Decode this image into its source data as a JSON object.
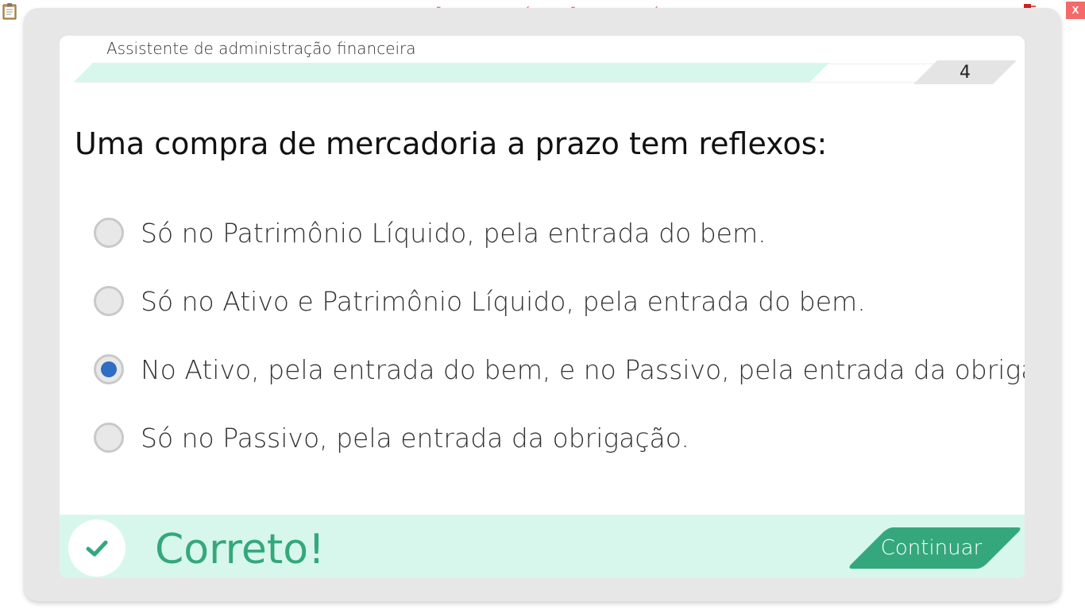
{
  "system": {
    "banner_text": "VERSÃO PARA FUNCIONÁRIOS - NÃO COMERCIALIZÁVEL",
    "close_label": "X"
  },
  "lesson": {
    "course_title": "Assistente de administração financeira",
    "progress_percent": 82,
    "page_number": "4"
  },
  "question": {
    "text": "Uma compra de mercadoria a prazo tem reflexos:",
    "options": [
      {
        "label": "Só no Patrimônio Líquido, pela entrada do bem.",
        "selected": false
      },
      {
        "label": "Só no Ativo e Patrimônio Líquido, pela entrada do bem.",
        "selected": false
      },
      {
        "label": "No Ativo, pela entrada do bem, e no Passivo, pela entrada da obrigação.",
        "selected": true
      },
      {
        "label": "Só no Passivo, pela entrada da obrigação.",
        "selected": false
      }
    ]
  },
  "feedback": {
    "result_text": "Correto!",
    "continue_label": "Continuar"
  },
  "colors": {
    "accent_green": "#34a87c",
    "light_green": "#d8f7ec",
    "radio_selected": "#2f6cc4",
    "banner_red": "#ee4b4b"
  },
  "icons": {
    "clipboard": "clipboard-icon",
    "tray": "network-tray-icon",
    "check": "check-icon"
  }
}
